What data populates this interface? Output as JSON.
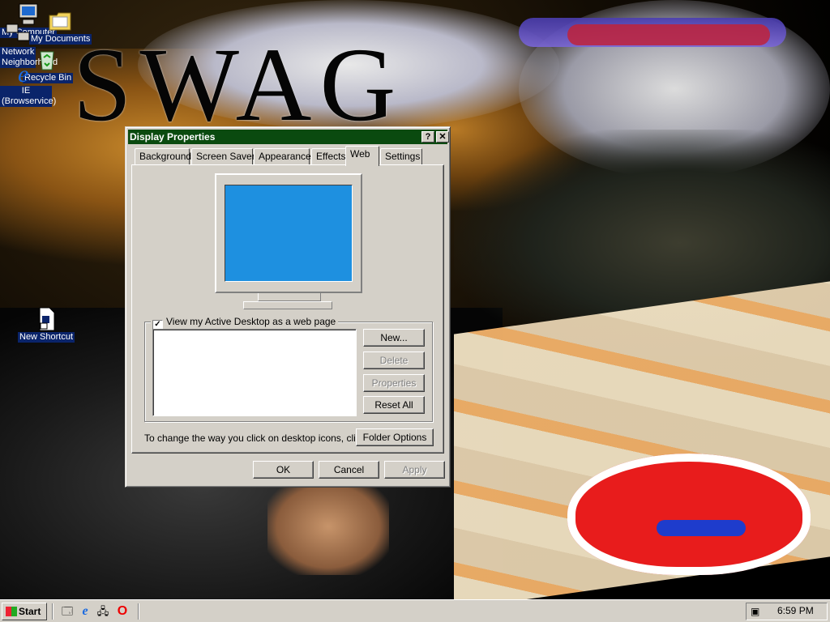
{
  "desktop": {
    "wallpaper_text": "SWAG",
    "icons": [
      {
        "label_line1": "My Computer",
        "label_line2": ""
      },
      {
        "label_line1": "My Documents",
        "label_line2": ""
      },
      {
        "label_line1": "Network",
        "label_line2": "Neighborhood"
      },
      {
        "label_line1": "Recycle Bin",
        "label_line2": ""
      },
      {
        "label_line1": "IE",
        "label_line2": "(Browservice)"
      },
      {
        "label_line1": "New Shortcut",
        "label_line2": ""
      }
    ]
  },
  "dialog": {
    "title": "Display Properties",
    "help_glyph": "?",
    "close_glyph": "✕",
    "tabs": [
      "Background",
      "Screen Saver",
      "Appearance",
      "Effects",
      "Web",
      "Settings"
    ],
    "active_tab": "Web",
    "checkbox_label": "View my Active Desktop as a web page",
    "checkbox_checked": true,
    "checkbox_mark": "✓",
    "side_buttons": {
      "new": "New...",
      "delete": "Delete",
      "properties": "Properties",
      "reset_all": "Reset All"
    },
    "folder_prompt": "To change the way you click on desktop icons, click:",
    "folder_options": "Folder Options",
    "footer": {
      "ok": "OK",
      "cancel": "Cancel",
      "apply": "Apply"
    }
  },
  "taskbar": {
    "start_label": "Start",
    "clock": "6:59 PM"
  },
  "colors": {
    "titlebar": "#0a4a0f",
    "face": "#d4d0c8",
    "preview_screen": "#1e90e0"
  }
}
